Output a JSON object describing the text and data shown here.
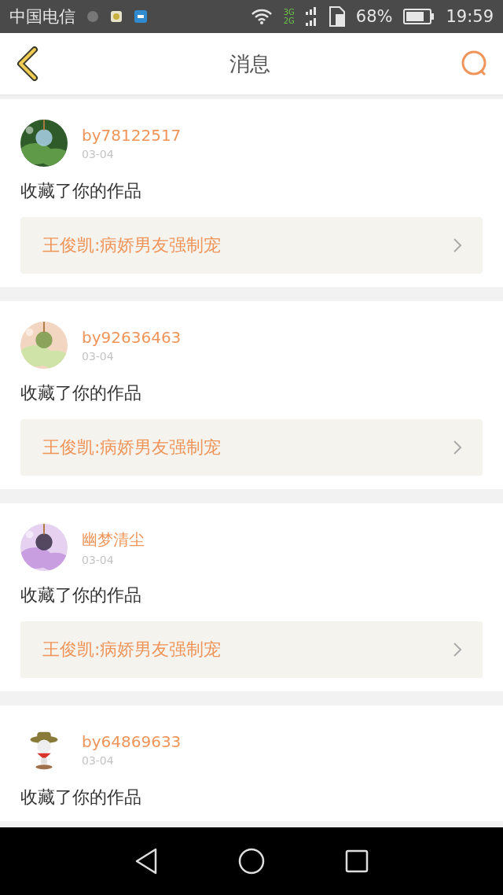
{
  "status_bar": {
    "carrier": "中国电信",
    "network_top": "3G",
    "network_bottom": "2G",
    "battery": "68%",
    "time": "19:59"
  },
  "header": {
    "title": "消息"
  },
  "messages": [
    {
      "user": "by78122517",
      "date": "03-04",
      "action": "收藏了你的作品",
      "work": "王俊凯:病娇男友强制宠"
    },
    {
      "user": "by92636463",
      "date": "03-04",
      "action": "收藏了你的作品",
      "work": "王俊凯:病娇男友强制宠"
    },
    {
      "user": "幽梦清尘",
      "date": "03-04",
      "action": "收藏了你的作品",
      "work": "王俊凯:病娇男友强制宠"
    },
    {
      "user": "by64869633",
      "date": "03-04",
      "action": "收藏了你的作品"
    }
  ]
}
